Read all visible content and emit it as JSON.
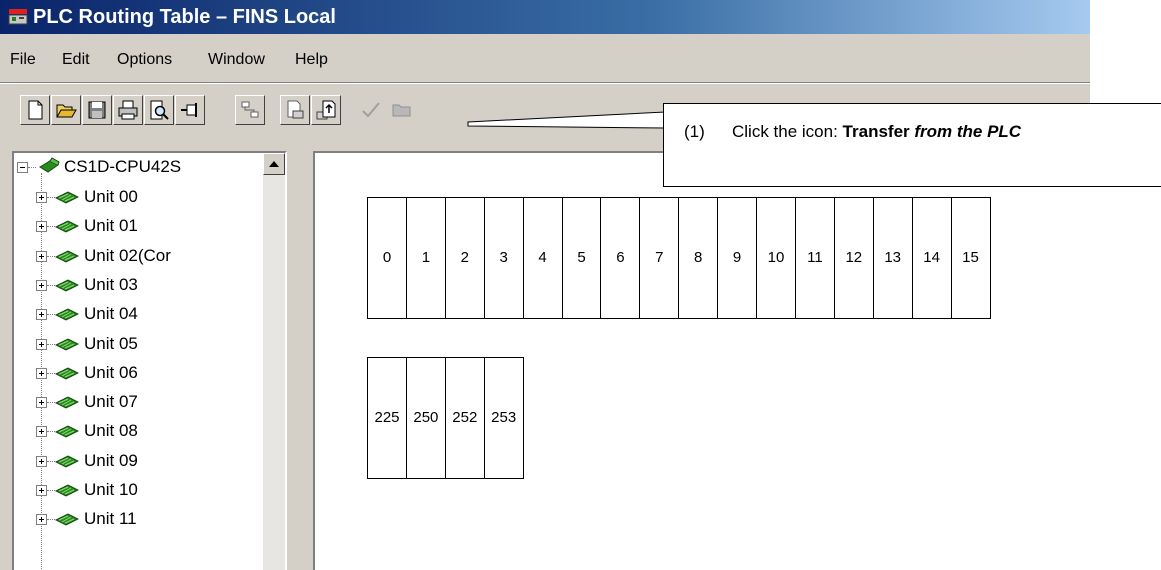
{
  "window": {
    "title": "PLC Routing Table – FINS Local"
  },
  "menu": [
    "File",
    "Edit",
    "Options",
    "Window",
    "Help"
  ],
  "toolbar": {
    "buttons": [
      "new-icon",
      "open-icon",
      "save-icon",
      "print-icon",
      "print-preview-icon",
      "pin-icon",
      "network-icon",
      "transfer-to-plc-icon",
      "transfer-from-plc-icon",
      "check-icon",
      "folder-icon"
    ]
  },
  "tree": {
    "root": "CS1D-CPU42S",
    "units": [
      "Unit 00",
      "Unit 01",
      "Unit 02(Cor",
      "Unit 03",
      "Unit 04",
      "Unit 05",
      "Unit 06",
      "Unit 07",
      "Unit 08",
      "Unit 09",
      "Unit 10",
      "Unit 11"
    ]
  },
  "table": {
    "local_nodes": [
      "0",
      "1",
      "2",
      "3",
      "4",
      "5",
      "6",
      "7",
      "8",
      "9",
      "10",
      "11",
      "12",
      "13",
      "14",
      "15"
    ],
    "remote_nodes": [
      "225",
      "250",
      "252",
      "253"
    ]
  },
  "callout": {
    "number": "(1)",
    "text_prefix": "Click the icon: ",
    "text_bold": "Transfer ",
    "text_bold_italic": "from the PLC"
  },
  "colors": {
    "titlebar_start": "#0a246a",
    "titlebar_end": "#a6caf0",
    "window_bg": "#d4d0c8",
    "unit_icon": "#2a8a1f"
  }
}
